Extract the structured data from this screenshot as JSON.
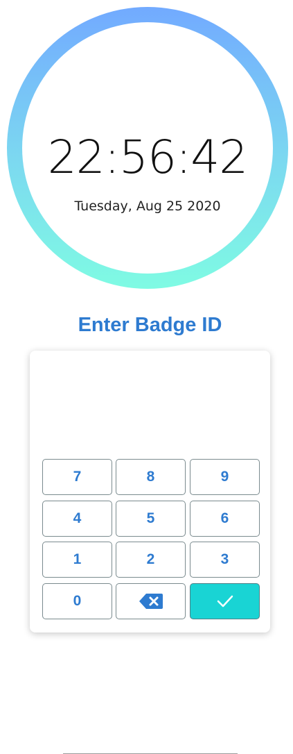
{
  "clock": {
    "time": "22:56:42",
    "date": "Tuesday, Aug 25 2020"
  },
  "badge": {
    "title": "Enter Badge ID",
    "input_value": ""
  },
  "keypad": {
    "keys": [
      "7",
      "8",
      "9",
      "4",
      "5",
      "6",
      "1",
      "2",
      "3",
      "0"
    ],
    "backspace_icon": "backspace-icon",
    "confirm_icon": "checkmark-icon"
  },
  "colors": {
    "accent_blue": "#2e7bd0",
    "confirm_teal": "#19d4d4",
    "ring_top": "#72aaff",
    "ring_bottom": "#7ffbe3"
  }
}
